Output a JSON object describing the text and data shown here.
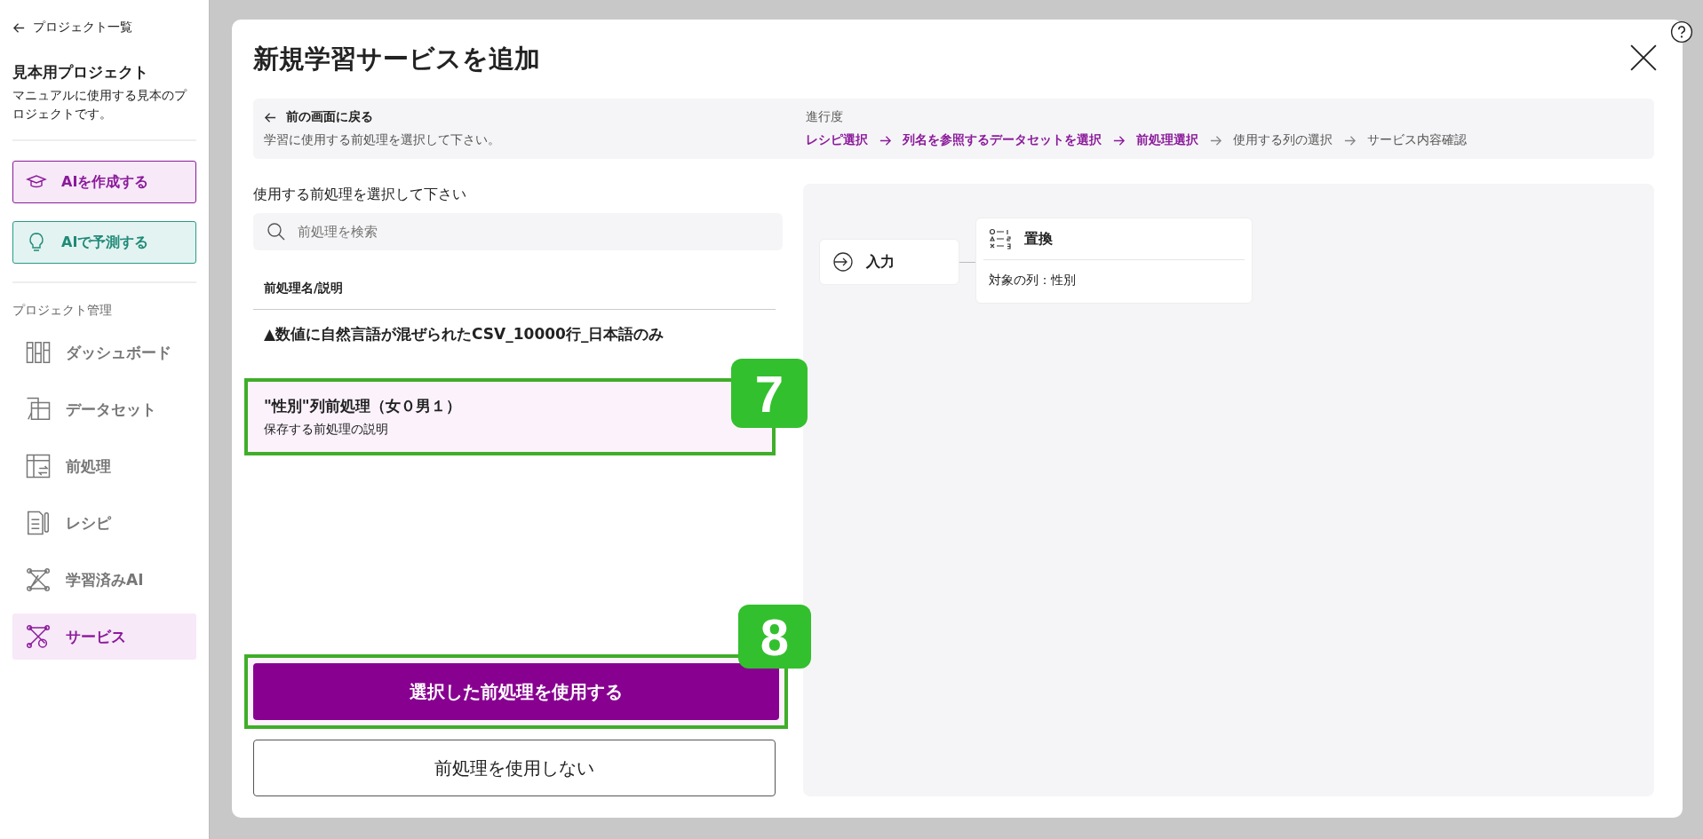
{
  "sidebar": {
    "back_link": "プロジェクト一覧",
    "project_title": "見本用プロジェクト",
    "project_description": "マニュアルに使用する見本のプロジェクトです。",
    "actions": [
      {
        "label": "AIを作成する",
        "kind": "create"
      },
      {
        "label": "AIで予測する",
        "kind": "predict"
      }
    ],
    "section_title": "プロジェクト管理",
    "items": [
      {
        "label": "ダッシュボード",
        "kind": "dashboard",
        "selected": false
      },
      {
        "label": "データセット",
        "kind": "dataset",
        "selected": false
      },
      {
        "label": "前処理",
        "kind": "preprocess",
        "selected": false
      },
      {
        "label": "レシピ",
        "kind": "recipe",
        "selected": false
      },
      {
        "label": "学習済みAI",
        "kind": "trained",
        "selected": false
      },
      {
        "label": "サービス",
        "kind": "service",
        "selected": true
      }
    ]
  },
  "dialog": {
    "title": "新規学習サービスを追加",
    "back_link": "前の画面に戻る",
    "instruction": "学習に使用する前処理を選択して下さい。",
    "progress_label": "進行度",
    "steps": [
      {
        "label": "レシピ選択",
        "active": true
      },
      {
        "label": "列名を参照するデータセットを選択",
        "active": true
      },
      {
        "label": "前処理選択",
        "active": true
      },
      {
        "label": "使用する列の選択",
        "active": false
      },
      {
        "label": "サービス内容確認",
        "active": false
      }
    ],
    "list_title": "使用する前処理を選択して下さい",
    "search": {
      "placeholder": "前処理を検索"
    },
    "column_header": "前処理名/説明",
    "preprocesses": [
      {
        "name": "▲数値に自然言語が混ぜられたCSV_10000行_日本語のみ",
        "selected": false
      },
      {
        "name": "\"性別\"列前処理（女０男１）",
        "description": "保存する前処理の説明",
        "selected": true,
        "callout": "7"
      }
    ],
    "buttons": [
      {
        "label": "選択した前処理を使用する",
        "kind": "primary",
        "callout": "8"
      },
      {
        "label": "前処理を使用しない",
        "kind": "secondary"
      }
    ],
    "flow": {
      "input_node": "入力",
      "step_node": {
        "title": "置換",
        "detail": "対象の列：性別"
      }
    }
  }
}
